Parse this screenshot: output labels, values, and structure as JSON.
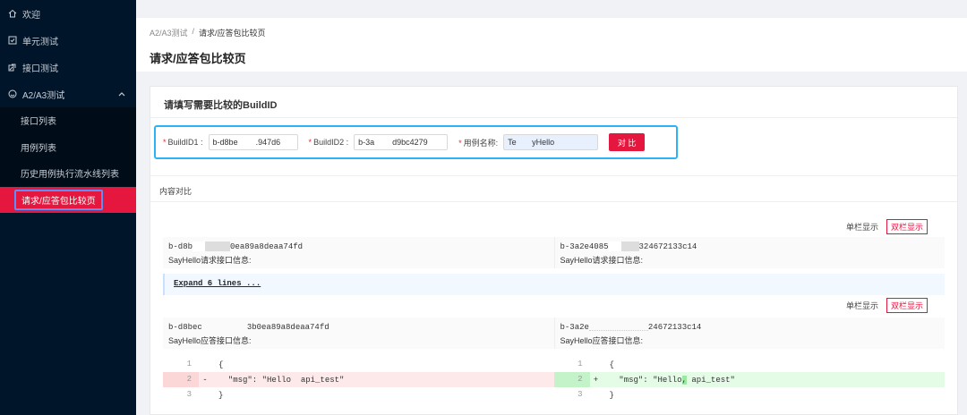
{
  "sidebar": {
    "items": [
      {
        "label": "欢迎",
        "icon": "home-icon"
      },
      {
        "label": "单元测试",
        "icon": "checkbox-icon"
      },
      {
        "label": "接口测试",
        "icon": "link-icon"
      }
    ],
    "group": {
      "label": "A2/A3测试",
      "icon": "smile-icon"
    },
    "subitems": [
      "接口列表",
      "用例列表",
      "历史用例执行流水线列表",
      "请求/应答包比较页"
    ]
  },
  "header": {
    "breadcrumb": [
      "A2/A3测试",
      "请求/应答包比较页"
    ],
    "separator": "/",
    "title": "请求/应答包比较页"
  },
  "form": {
    "title": "请填写需要比较的BuildID",
    "buildid1_label": "BuildID1 :",
    "buildid1_value": "b-d8be        .947d6",
    "buildid2_label": "BuildID2 :",
    "buildid2_value": "b-3a        d9bc4279",
    "case_label": "用例名称:",
    "case_value": "Te       yHello",
    "compare_label": "对 比",
    "required_mark": "*"
  },
  "content": {
    "section_title": "内容对比",
    "toggle_single": "单栏显示",
    "toggle_double": "双栏显示",
    "request": {
      "left_id_a": "b-d8b",
      "left_id_b": "0ea89a8deaa74fd",
      "right_id_a": "b-3a2e4085",
      "right_id_b": "324672133c14",
      "left_label": "SayHello请求接口信息:",
      "right_label": "SayHello请求接口信息:"
    },
    "expand_label": "Expand 6 lines ...",
    "response": {
      "left_id_a": "b-d8bec",
      "left_id_b": "3b0ea89a8deaa74fd",
      "right_id_a": "b-3a2e",
      "right_id_b": "24672133c14",
      "left_label": "SayHello应答接口信息:",
      "right_label": "SayHello应答接口信息:"
    },
    "diff_left": [
      {
        "num": "1",
        "mark": "",
        "text": "{"
      },
      {
        "num": "2",
        "mark": "-",
        "text": "  \"msg\": \"Hello  api_test\""
      },
      {
        "num": "3",
        "mark": "",
        "text": "}"
      }
    ],
    "diff_right": [
      {
        "num": "1",
        "mark": "",
        "text": "{"
      },
      {
        "num": "2",
        "mark": "+",
        "text_a": "  \"msg\": \"Hello",
        "text_hl": ",",
        "text_b": " api_test\""
      },
      {
        "num": "3",
        "mark": "",
        "text": "}"
      }
    ]
  },
  "colors": {
    "accent": "#e5173f",
    "sidebar": "#001529",
    "focus": "#2db3f5"
  }
}
